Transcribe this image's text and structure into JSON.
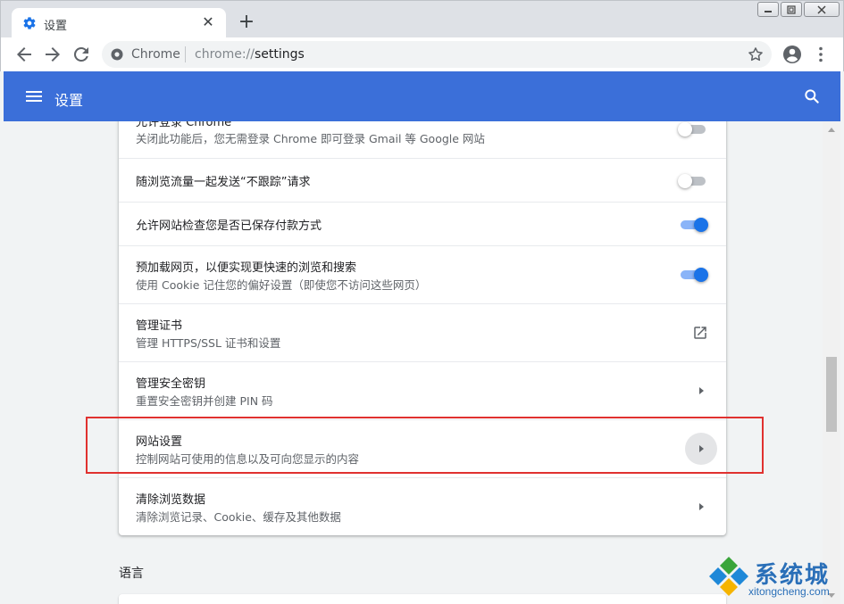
{
  "tab": {
    "title": "设置",
    "close": "✕",
    "new_tab": "+"
  },
  "window_controls": {
    "minimize": "▭",
    "restore": "◫",
    "close": "✕"
  },
  "omnibox": {
    "site_name": "Chrome",
    "url_scheme": "chrome://",
    "url_path": "settings"
  },
  "header": {
    "title": "设置"
  },
  "settings_rows": [
    {
      "primary": "允许登录 Chrome",
      "secondary": "关闭此功能后，您无需登录 Chrome 即可登录 Gmail 等 Google 网站",
      "control": "toggle-off"
    },
    {
      "primary": "随浏览流量一起发送“不跟踪”请求",
      "control": "toggle-off"
    },
    {
      "primary": "允许网站检查您是否已保存付款方式",
      "control": "toggle-on"
    },
    {
      "primary": "预加载网页，以便实现更快速的浏览和搜索",
      "secondary": "使用 Cookie 记住您的偏好设置（即使您不访问这些网页）",
      "control": "toggle-on"
    },
    {
      "primary": "管理证书",
      "secondary": "管理 HTTPS/SSL 证书和设置",
      "control": "external-link"
    },
    {
      "primary": "管理安全密钥",
      "secondary": "重置安全密钥并创建 PIN 码",
      "control": "arrow"
    },
    {
      "primary": "网站设置",
      "secondary": "控制网站可使用的信息以及可向您显示的内容",
      "control": "arrow-hover"
    },
    {
      "primary": "清除浏览数据",
      "secondary": "清除浏览记录、Cookie、缓存及其他数据",
      "control": "arrow"
    }
  ],
  "section": {
    "language_label": "语言"
  },
  "watermark": {
    "name": "系统城",
    "url": "xitongcheng.com"
  },
  "colors": {
    "header_blue": "#3b6fd9",
    "toggle_on": "#1a73e8",
    "highlight_red": "#e0312f"
  }
}
